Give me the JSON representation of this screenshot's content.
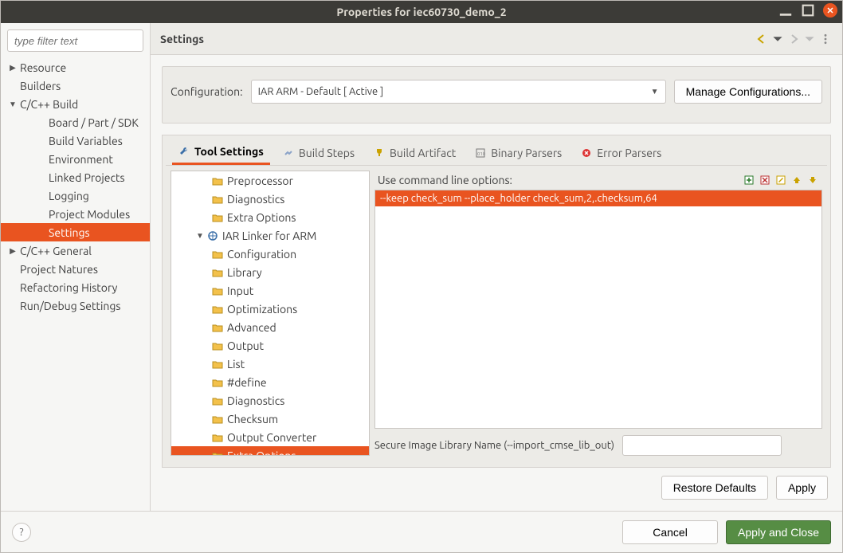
{
  "window": {
    "title": "Properties for iec60730_demo_2"
  },
  "filter": {
    "placeholder": "type filter text"
  },
  "sidebar": {
    "items": [
      {
        "label": "Resource",
        "expandable": true,
        "expanded": false,
        "level": 0
      },
      {
        "label": "Builders",
        "expandable": false,
        "level": 0
      },
      {
        "label": "C/C++ Build",
        "expandable": true,
        "expanded": true,
        "level": 0
      },
      {
        "label": "Board / Part / SDK",
        "level": 1
      },
      {
        "label": "Build Variables",
        "level": 1
      },
      {
        "label": "Environment",
        "level": 1
      },
      {
        "label": "Linked Projects",
        "level": 1
      },
      {
        "label": "Logging",
        "level": 1
      },
      {
        "label": "Project Modules",
        "level": 1
      },
      {
        "label": "Settings",
        "level": 1,
        "selected": true
      },
      {
        "label": "C/C++ General",
        "expandable": true,
        "expanded": false,
        "level": 0
      },
      {
        "label": "Project Natures",
        "level": 0
      },
      {
        "label": "Refactoring History",
        "level": 0
      },
      {
        "label": "Run/Debug Settings",
        "level": 0
      }
    ]
  },
  "panel": {
    "title": "Settings",
    "config_label": "Configuration:",
    "config_value": "IAR ARM - Default  [ Active ]",
    "manage_btn": "Manage Configurations...",
    "tabs": [
      {
        "label": "Tool Settings",
        "icon": "wrench",
        "active": true
      },
      {
        "label": "Build Steps",
        "icon": "steps"
      },
      {
        "label": "Build Artifact",
        "icon": "trophy"
      },
      {
        "label": "Binary Parsers",
        "icon": "binary"
      },
      {
        "label": "Error Parsers",
        "icon": "error"
      }
    ],
    "tool_tree": [
      {
        "label": "Preprocessor",
        "level": 2,
        "icon": "folder"
      },
      {
        "label": "Diagnostics",
        "level": 2,
        "icon": "folder"
      },
      {
        "label": "Extra Options",
        "level": 2,
        "icon": "folder"
      },
      {
        "label": "IAR Linker for ARM",
        "level": 1,
        "icon": "ship",
        "expandable": true,
        "expanded": true
      },
      {
        "label": "Configuration",
        "level": 2,
        "icon": "folder"
      },
      {
        "label": "Library",
        "level": 2,
        "icon": "folder"
      },
      {
        "label": "Input",
        "level": 2,
        "icon": "folder"
      },
      {
        "label": "Optimizations",
        "level": 2,
        "icon": "folder"
      },
      {
        "label": "Advanced",
        "level": 2,
        "icon": "folder"
      },
      {
        "label": "Output",
        "level": 2,
        "icon": "folder"
      },
      {
        "label": "List",
        "level": 2,
        "icon": "folder"
      },
      {
        "label": "#define",
        "level": 2,
        "icon": "folder"
      },
      {
        "label": "Diagnostics",
        "level": 2,
        "icon": "folder"
      },
      {
        "label": "Checksum",
        "level": 2,
        "icon": "folder"
      },
      {
        "label": "Output Converter",
        "level": 2,
        "icon": "folder"
      },
      {
        "label": "Extra Options",
        "level": 2,
        "icon": "folder",
        "selected": true
      }
    ],
    "opts_label": "Use command line options:",
    "opts_entries": [
      "--keep check_sum --place_holder check_sum,2,.checksum,64"
    ],
    "secure_label": "Secure Image Library Name (--import_cmse_lib_out)",
    "secure_value": "",
    "restore_btn": "Restore Defaults",
    "apply_btn": "Apply"
  },
  "footer": {
    "cancel": "Cancel",
    "apply_close": "Apply and Close"
  }
}
